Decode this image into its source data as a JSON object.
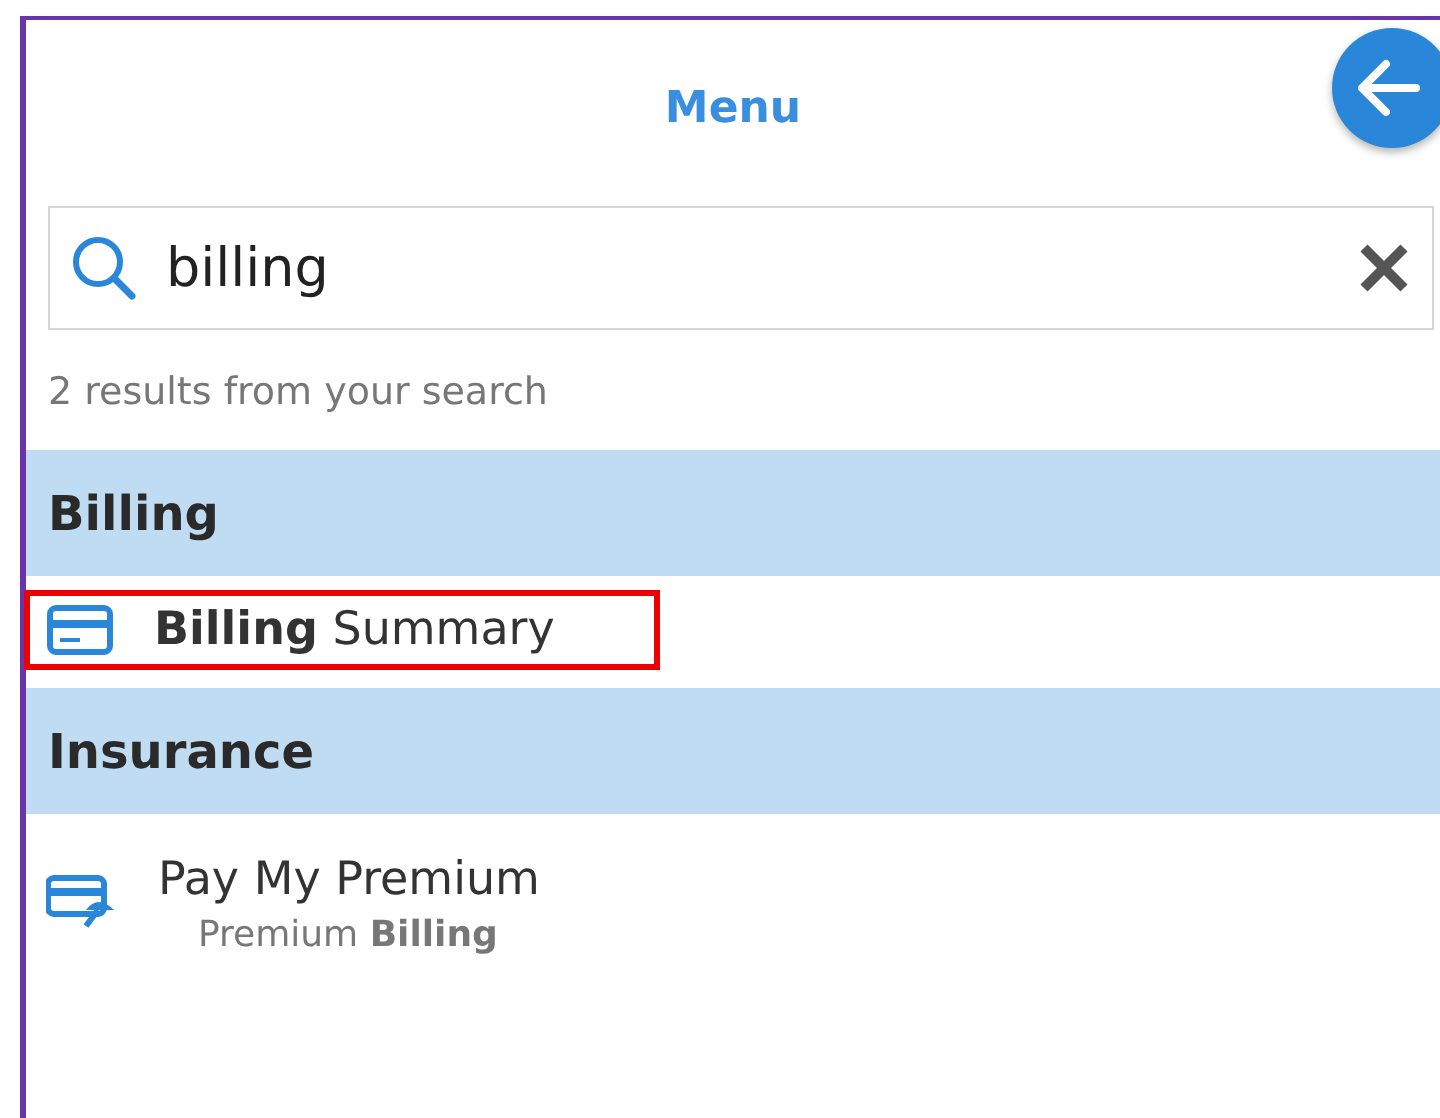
{
  "title": "Menu",
  "search": {
    "value": "billing"
  },
  "result_count": "2 results from your search",
  "groups": [
    {
      "label": "Billing",
      "items": [
        {
          "kind": "card",
          "label": "**Billing** Summary",
          "highlighted": true
        }
      ]
    },
    {
      "label": "Insurance",
      "items": [
        {
          "kind": "card-pay",
          "label": "Pay My Premium",
          "subtitle": "Premium **Billing**",
          "highlighted": false
        }
      ]
    }
  ]
}
